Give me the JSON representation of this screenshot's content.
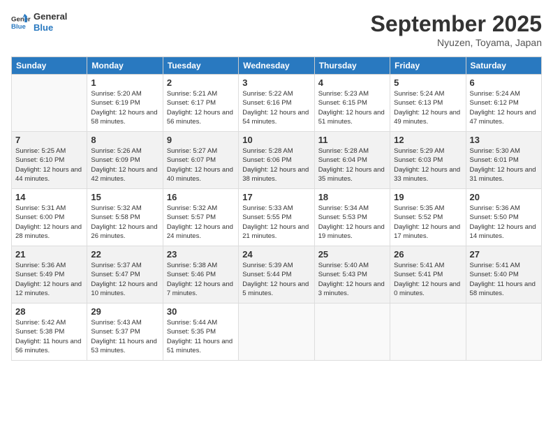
{
  "logo": {
    "line1": "General",
    "line2": "Blue"
  },
  "title": "September 2025",
  "subtitle": "Nyuzen, Toyama, Japan",
  "weekdays": [
    "Sunday",
    "Monday",
    "Tuesday",
    "Wednesday",
    "Thursday",
    "Friday",
    "Saturday"
  ],
  "weeks": [
    [
      {
        "day": null
      },
      {
        "day": "1",
        "sunrise": "5:20 AM",
        "sunset": "6:19 PM",
        "daylight": "12 hours and 58 minutes."
      },
      {
        "day": "2",
        "sunrise": "5:21 AM",
        "sunset": "6:17 PM",
        "daylight": "12 hours and 56 minutes."
      },
      {
        "day": "3",
        "sunrise": "5:22 AM",
        "sunset": "6:16 PM",
        "daylight": "12 hours and 54 minutes."
      },
      {
        "day": "4",
        "sunrise": "5:23 AM",
        "sunset": "6:15 PM",
        "daylight": "12 hours and 51 minutes."
      },
      {
        "day": "5",
        "sunrise": "5:24 AM",
        "sunset": "6:13 PM",
        "daylight": "12 hours and 49 minutes."
      },
      {
        "day": "6",
        "sunrise": "5:24 AM",
        "sunset": "6:12 PM",
        "daylight": "12 hours and 47 minutes."
      }
    ],
    [
      {
        "day": "7",
        "sunrise": "5:25 AM",
        "sunset": "6:10 PM",
        "daylight": "12 hours and 44 minutes."
      },
      {
        "day": "8",
        "sunrise": "5:26 AM",
        "sunset": "6:09 PM",
        "daylight": "12 hours and 42 minutes."
      },
      {
        "day": "9",
        "sunrise": "5:27 AM",
        "sunset": "6:07 PM",
        "daylight": "12 hours and 40 minutes."
      },
      {
        "day": "10",
        "sunrise": "5:28 AM",
        "sunset": "6:06 PM",
        "daylight": "12 hours and 38 minutes."
      },
      {
        "day": "11",
        "sunrise": "5:28 AM",
        "sunset": "6:04 PM",
        "daylight": "12 hours and 35 minutes."
      },
      {
        "day": "12",
        "sunrise": "5:29 AM",
        "sunset": "6:03 PM",
        "daylight": "12 hours and 33 minutes."
      },
      {
        "day": "13",
        "sunrise": "5:30 AM",
        "sunset": "6:01 PM",
        "daylight": "12 hours and 31 minutes."
      }
    ],
    [
      {
        "day": "14",
        "sunrise": "5:31 AM",
        "sunset": "6:00 PM",
        "daylight": "12 hours and 28 minutes."
      },
      {
        "day": "15",
        "sunrise": "5:32 AM",
        "sunset": "5:58 PM",
        "daylight": "12 hours and 26 minutes."
      },
      {
        "day": "16",
        "sunrise": "5:32 AM",
        "sunset": "5:57 PM",
        "daylight": "12 hours and 24 minutes."
      },
      {
        "day": "17",
        "sunrise": "5:33 AM",
        "sunset": "5:55 PM",
        "daylight": "12 hours and 21 minutes."
      },
      {
        "day": "18",
        "sunrise": "5:34 AM",
        "sunset": "5:53 PM",
        "daylight": "12 hours and 19 minutes."
      },
      {
        "day": "19",
        "sunrise": "5:35 AM",
        "sunset": "5:52 PM",
        "daylight": "12 hours and 17 minutes."
      },
      {
        "day": "20",
        "sunrise": "5:36 AM",
        "sunset": "5:50 PM",
        "daylight": "12 hours and 14 minutes."
      }
    ],
    [
      {
        "day": "21",
        "sunrise": "5:36 AM",
        "sunset": "5:49 PM",
        "daylight": "12 hours and 12 minutes."
      },
      {
        "day": "22",
        "sunrise": "5:37 AM",
        "sunset": "5:47 PM",
        "daylight": "12 hours and 10 minutes."
      },
      {
        "day": "23",
        "sunrise": "5:38 AM",
        "sunset": "5:46 PM",
        "daylight": "12 hours and 7 minutes."
      },
      {
        "day": "24",
        "sunrise": "5:39 AM",
        "sunset": "5:44 PM",
        "daylight": "12 hours and 5 minutes."
      },
      {
        "day": "25",
        "sunrise": "5:40 AM",
        "sunset": "5:43 PM",
        "daylight": "12 hours and 3 minutes."
      },
      {
        "day": "26",
        "sunrise": "5:41 AM",
        "sunset": "5:41 PM",
        "daylight": "12 hours and 0 minutes."
      },
      {
        "day": "27",
        "sunrise": "5:41 AM",
        "sunset": "5:40 PM",
        "daylight": "11 hours and 58 minutes."
      }
    ],
    [
      {
        "day": "28",
        "sunrise": "5:42 AM",
        "sunset": "5:38 PM",
        "daylight": "11 hours and 56 minutes."
      },
      {
        "day": "29",
        "sunrise": "5:43 AM",
        "sunset": "5:37 PM",
        "daylight": "11 hours and 53 minutes."
      },
      {
        "day": "30",
        "sunrise": "5:44 AM",
        "sunset": "5:35 PM",
        "daylight": "11 hours and 51 minutes."
      },
      {
        "day": null
      },
      {
        "day": null
      },
      {
        "day": null
      },
      {
        "day": null
      }
    ]
  ]
}
